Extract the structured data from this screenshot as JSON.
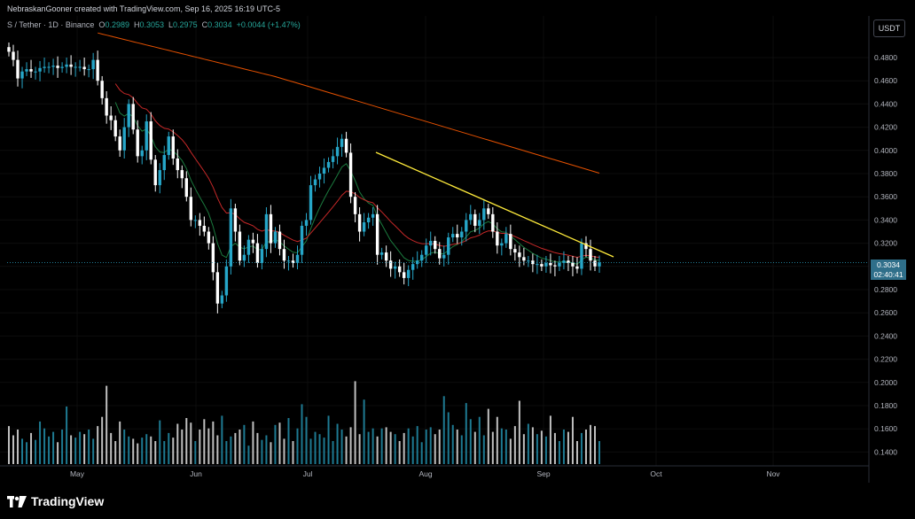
{
  "header": {
    "author_line": "NebraskanGooner created with TradingView.com, Sep 16, 2025 16:19 UTC-5"
  },
  "legend": {
    "symbol": "S / Tether",
    "interval": "1D",
    "exchange": "Binance",
    "open_label": "O",
    "open": "0.2989",
    "high_label": "H",
    "high": "0.3053",
    "low_label": "L",
    "low": "0.2975",
    "close_label": "C",
    "close": "0.3034",
    "change": "+0.0044 (+1.47%)"
  },
  "price_axis": {
    "unit_label": "USDT",
    "last_price": "0.3034",
    "countdown": "02:40:41"
  },
  "brand": {
    "name": "TradingView"
  },
  "colors": {
    "up": "#26a6c8",
    "down": "#ffffff",
    "ema_fast": "#1b7a3e",
    "ema_mid": "#c62828",
    "ema_slow": "#e65100",
    "trendline": "#ffeb3b"
  },
  "chart_data": {
    "type": "candlestick",
    "y_ticks": [
      "0.4800",
      "0.4600",
      "0.4400",
      "0.4200",
      "0.4000",
      "0.3800",
      "0.3600",
      "0.3400",
      "0.3200",
      "0.3000",
      "0.2800",
      "0.2600",
      "0.2400",
      "0.2200",
      "0.2000",
      "0.1800",
      "0.1600",
      "0.1400"
    ],
    "x_ticks": [
      "May",
      "Jun",
      "Jul",
      "Aug",
      "Sep",
      "Oct",
      "Nov"
    ],
    "ylim": [
      0.135,
      0.51
    ],
    "last_price": 0.3034,
    "close": [
      0.485,
      0.478,
      0.462,
      0.468,
      0.47,
      0.468,
      0.468,
      0.471,
      0.472,
      0.472,
      0.473,
      0.471,
      0.472,
      0.474,
      0.472,
      0.472,
      0.472,
      0.47,
      0.47,
      0.478,
      0.46,
      0.445,
      0.43,
      0.426,
      0.412,
      0.4,
      0.42,
      0.44,
      0.418,
      0.395,
      0.4,
      0.425,
      0.392,
      0.37,
      0.383,
      0.396,
      0.412,
      0.393,
      0.383,
      0.376,
      0.36,
      0.34,
      0.34,
      0.335,
      0.33,
      0.32,
      0.295,
      0.268,
      0.275,
      0.3,
      0.35,
      0.33,
      0.305,
      0.31,
      0.323,
      0.32,
      0.303,
      0.315,
      0.345,
      0.32,
      0.33,
      0.315,
      0.305,
      0.305,
      0.303,
      0.31,
      0.335,
      0.34,
      0.37,
      0.375,
      0.38,
      0.385,
      0.39,
      0.395,
      0.403,
      0.41,
      0.398,
      0.36,
      0.345,
      0.33,
      0.338,
      0.342,
      0.345,
      0.31,
      0.312,
      0.305,
      0.298,
      0.3,
      0.295,
      0.29,
      0.297,
      0.302,
      0.305,
      0.31,
      0.318,
      0.322,
      0.315,
      0.307,
      0.31,
      0.325,
      0.328,
      0.325,
      0.33,
      0.34,
      0.345,
      0.335,
      0.34,
      0.35,
      0.345,
      0.33,
      0.318,
      0.32,
      0.328,
      0.315,
      0.312,
      0.308,
      0.305,
      0.305,
      0.302,
      0.302,
      0.3,
      0.303,
      0.301,
      0.3,
      0.303,
      0.305,
      0.303,
      0.3,
      0.298,
      0.32,
      0.315,
      0.305,
      0.3,
      0.3034
    ],
    "volume_relative": [
      0.33,
      0.25,
      0.3,
      0.22,
      0.19,
      0.27,
      0.21,
      0.37,
      0.31,
      0.24,
      0.28,
      0.19,
      0.3,
      0.5,
      0.25,
      0.23,
      0.28,
      0.26,
      0.3,
      0.22,
      0.33,
      0.41,
      0.68,
      0.27,
      0.2,
      0.37,
      0.3,
      0.24,
      0.22,
      0.18,
      0.23,
      0.26,
      0.24,
      0.2,
      0.38,
      0.2,
      0.27,
      0.23,
      0.35,
      0.3,
      0.4,
      0.36,
      0.2,
      0.3,
      0.39,
      0.31,
      0.37,
      0.25,
      0.42,
      0.2,
      0.24,
      0.27,
      0.3,
      0.34,
      0.16,
      0.37,
      0.27,
      0.21,
      0.25,
      0.19,
      0.34,
      0.36,
      0.22,
      0.4,
      0.2,
      0.31,
      0.52,
      0.41,
      0.22,
      0.28,
      0.26,
      0.23,
      0.42,
      0.2,
      0.35,
      0.3,
      0.24,
      0.32,
      0.72,
      0.26,
      0.56,
      0.28,
      0.31,
      0.24,
      0.31,
      0.32,
      0.28,
      0.26,
      0.2,
      0.27,
      0.31,
      0.24,
      0.33,
      0.19,
      0.3,
      0.32,
      0.26,
      0.3,
      0.59,
      0.45,
      0.34,
      0.3,
      0.25,
      0.53,
      0.39,
      0.28,
      0.41,
      0.25,
      0.48,
      0.28,
      0.41,
      0.31,
      0.3,
      0.22,
      0.33,
      0.55,
      0.26,
      0.35,
      0.32,
      0.26,
      0.29,
      0.24,
      0.42,
      0.27,
      0.2,
      0.3,
      0.28,
      0.41,
      0.2,
      0.27,
      0.3,
      0.34,
      0.33,
      0.2,
      0.3,
      0.18
    ]
  }
}
